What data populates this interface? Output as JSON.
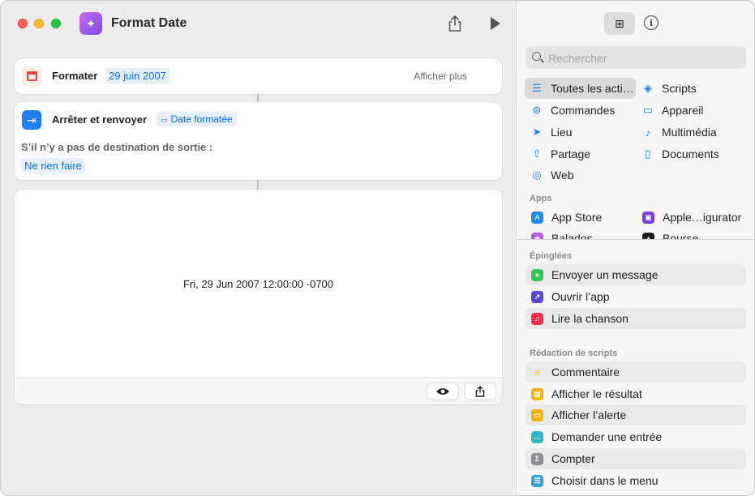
{
  "window": {
    "title": "Format Date"
  },
  "card_format": {
    "label": "Formater",
    "token": "29 juin 2007",
    "more": "Afficher plus"
  },
  "card_stop": {
    "label": "Arrêter et renvoyer",
    "token": "Date formatée",
    "subtitle": "S’il n’y a pas de destination de sortie :",
    "option": "Ne rien faire"
  },
  "result": {
    "text": "Fri, 29 Jun 2007 12:00:00 -0700"
  },
  "sidebar": {
    "search_placeholder": "Rechercher",
    "categories": [
      {
        "label": "Toutes les acti…",
        "icon": "list-icon"
      },
      {
        "label": "Scripts",
        "icon": "scripts-icon"
      },
      {
        "label": "Commandes",
        "icon": "toggles-icon"
      },
      {
        "label": "Appareil",
        "icon": "display-icon"
      },
      {
        "label": "Lieu",
        "icon": "location-arrow-icon"
      },
      {
        "label": "Multimédia",
        "icon": "music-note-icon"
      },
      {
        "label": "Partage",
        "icon": "share-icon"
      },
      {
        "label": "Documents",
        "icon": "document-icon"
      },
      {
        "label": "Web",
        "icon": "compass-icon"
      }
    ],
    "apps_header": "Apps",
    "apps": [
      {
        "label": "App Store",
        "color": "#1d8cf2"
      },
      {
        "label": "Apple…igurator",
        "color": "#7a3fd1"
      },
      {
        "label": "Balados",
        "color": "#b15be0"
      },
      {
        "label": "Bourse",
        "color": "#1c1c1e"
      }
    ],
    "pinned_header": "Épinglées",
    "pinned": [
      {
        "label": "Envoyer un message",
        "color": "#34c759"
      },
      {
        "label": "Ouvrir l’app",
        "color": "#5a4bd6"
      },
      {
        "label": "Lire la chanson",
        "color": "#fa2d48"
      }
    ],
    "scripting_header": "Rédaction de scripts",
    "scripting": [
      {
        "label": "Commentaire",
        "color": "#f7c948"
      },
      {
        "label": "Afficher le résultat",
        "color": "#f5b400"
      },
      {
        "label": "Afficher l’alerte",
        "color": "#f5b400"
      },
      {
        "label": "Demander une entrée",
        "color": "#32b5c6"
      },
      {
        "label": "Compter",
        "color": "#8e8e93"
      },
      {
        "label": "Choisir dans le menu",
        "color": "#32a5d6"
      }
    ]
  }
}
